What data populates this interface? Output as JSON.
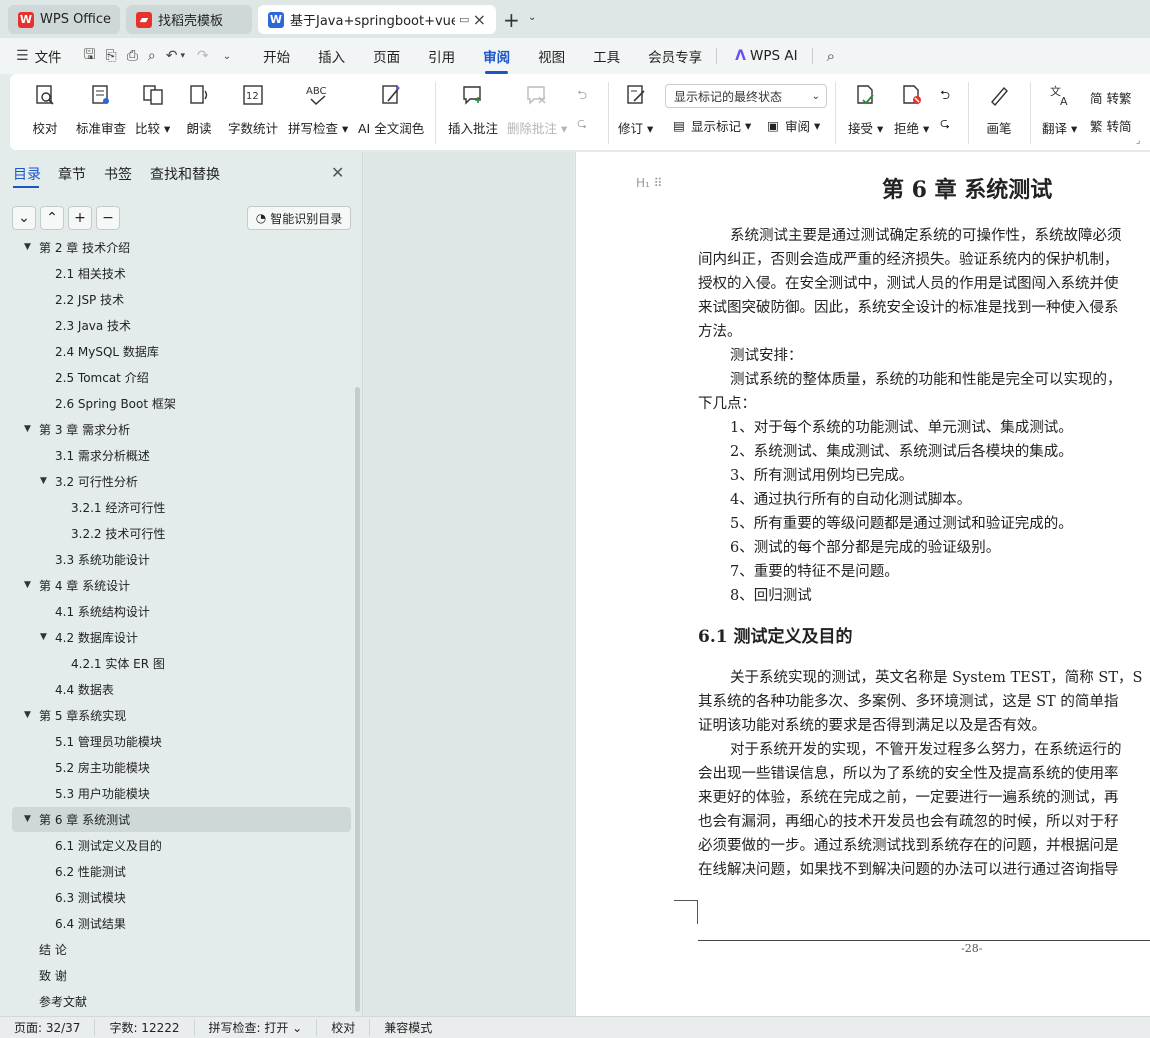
{
  "tabs": {
    "tab1": {
      "label": "WPS Office",
      "icon": "wps-logo-icon"
    },
    "tab2": {
      "label": "找稻壳模板",
      "icon": "docer-icon"
    },
    "tab3": {
      "label": "基于Java+springboot+vue·",
      "icon": "word-doc-icon"
    }
  },
  "menu": {
    "file": "文件",
    "items": [
      "开始",
      "插入",
      "页面",
      "引用",
      "审阅",
      "视图",
      "工具",
      "会员专享"
    ],
    "active": "审阅",
    "ai": "WPS AI"
  },
  "ribbon": {
    "proofread": "校对",
    "standard_review": "标准审查",
    "compare": "比较",
    "read_aloud": "朗读",
    "word_count": "字数统计",
    "spell_check": "拼写检查",
    "ai_polish": "AI 全文润色",
    "insert_comment": "插入批注",
    "delete_comment": "删除批注",
    "revise": "修订",
    "markup_select": "显示标记的最终状态",
    "show_markup": "显示标记",
    "review": "审阅",
    "accept": "接受",
    "reject": "拒绝",
    "pen": "画笔",
    "translate": "翻译",
    "to_traditional": "简 转繁",
    "to_simplified": "繁 转简"
  },
  "panel": {
    "tabs": [
      "目录",
      "章节",
      "书签",
      "查找和替换"
    ],
    "active_tab": "目录",
    "smart_toc": "智能识别目录"
  },
  "toc": [
    {
      "label": "第 2 章  技术介绍"
    },
    {
      "label": "2.1 相关技术"
    },
    {
      "label": "2.2 JSP 技术"
    },
    {
      "label": "2.3 Java 技术"
    },
    {
      "label": "2.4 MySQL 数据库"
    },
    {
      "label": "2.5 Tomcat 介绍"
    },
    {
      "label": "2.6 Spring Boot 框架"
    },
    {
      "label": "第 3 章  需求分析"
    },
    {
      "label": "3.1 需求分析概述"
    },
    {
      "label": "3.2 可行性分析"
    },
    {
      "label": "3.2.1 经济可行性"
    },
    {
      "label": "3.2.2 技术可行性"
    },
    {
      "label": "3.3 系统功能设计"
    },
    {
      "label": "第 4 章  系统设计"
    },
    {
      "label": "4.1 系统结构设计"
    },
    {
      "label": "4.2 数据库设计"
    },
    {
      "label": "4.2.1 实体 ER 图"
    },
    {
      "label": "4.4  数据表"
    },
    {
      "label": "第 5 章系统实现"
    },
    {
      "label": "5.1 管理员功能模块"
    },
    {
      "label": "5.2 房主功能模块"
    },
    {
      "label": "5.3 用户功能模块"
    },
    {
      "label": "第 6 章  系统测试"
    },
    {
      "label": "6.1 测试定义及目的"
    },
    {
      "label": "6.2 性能测试"
    },
    {
      "label": "6.3 测试模块"
    },
    {
      "label": "6.4 测试结果"
    },
    {
      "label": "结    论"
    },
    {
      "label": "致    谢"
    },
    {
      "label": "参考文献"
    }
  ],
  "document": {
    "chapter_title": "第 6 章  系统测试",
    "heading_marker": "H₁",
    "lines": [
      "系统测试主要是通过测试确定系统的可操作性，系统故障必须",
      "间内纠正，否则会造成严重的经济损失。验证系统内的保护机制，",
      "授权的入侵。在安全测试中，测试人员的作用是试图闯入系统并使",
      "来试图突破防御。因此，系统安全设计的标准是找到一种使入侵系",
      "方法。",
      "测试安排：",
      "测试系统的整体质量，系统的功能和性能是完全可以实现的，",
      "下几点：",
      "1、对于每个系统的功能测试、单元测试、集成测试。",
      "2、系统测试、集成测试、系统测试后各模块的集成。",
      "3、所有测试用例均已完成。",
      "4、通过执行所有的自动化测试脚本。",
      "5、所有重要的等级问题都是通过测试和验证完成的。",
      "6、测试的每个部分都是完成的验证级别。",
      "7、重要的特征不是问题。",
      "8、回归测试"
    ],
    "section_title": "6.1 测试定义及目的",
    "lines2": [
      "关于系统实现的测试，英文名称是 System TEST，简称 ST，S",
      "其系统的各种功能多次、多案例、多环境测试，这是 ST 的简单指",
      "证明该功能对系统的要求是否得到满足以及是否有效。",
      "对于系统开发的实现，不管开发过程多么努力，在系统运行的",
      "会出现一些错误信息，所以为了系统的安全性及提高系统的使用率",
      "来更好的体验，系统在完成之前，一定要进行一遍系统的测试，再",
      "也会有漏洞，再细心的技术开发员也会有疏忽的时候，所以对于秄",
      "必须要做的一步。通过系统测试找到系统存在的问题，并根据问是",
      "在线解决问题，如果找不到解决问题的办法可以进行通过咨询指导"
    ],
    "page_number": "-28-"
  },
  "status": {
    "page": "页面: 32/37",
    "words": "字数: 12222",
    "spell": "拼写检查: 打开",
    "proof": "校对",
    "compat": "兼容模式"
  },
  "colors": {
    "accent": "#1b56c9",
    "wps_red": "#e5322d",
    "word_blue": "#2c68d8"
  }
}
